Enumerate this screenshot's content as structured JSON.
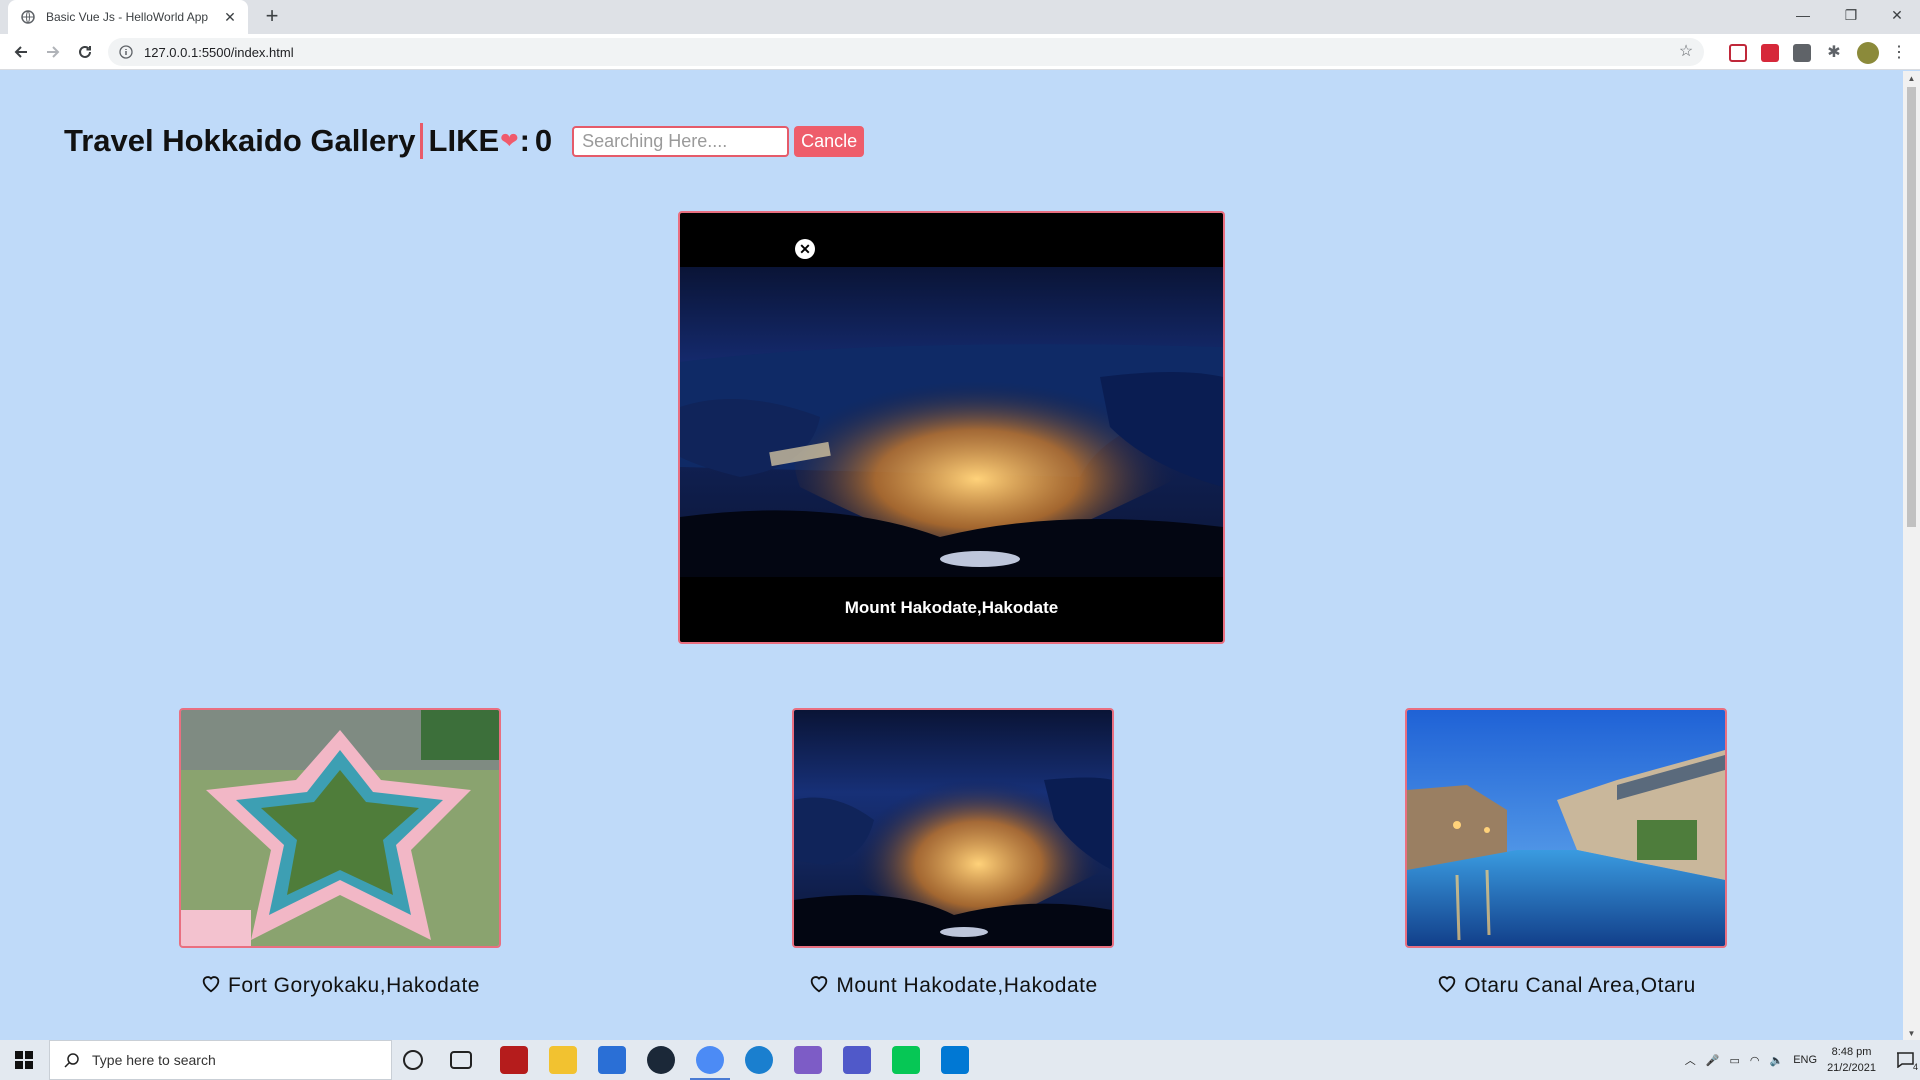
{
  "browser": {
    "tab_title": "Basic Vue Js - HelloWorld App",
    "url": "127.0.0.1:5500/index.html"
  },
  "app": {
    "title": "Travel Hokkaido Gallery",
    "like_label": "LIKE",
    "like_colon": ":",
    "like_count": "0",
    "search_placeholder": "Searching Here....",
    "cancel_label": "Cancle"
  },
  "lightbox": {
    "caption": "Mount Hakodate,Hakodate"
  },
  "gallery": [
    {
      "caption": "Fort Goryokaku,Hakodate"
    },
    {
      "caption": "Mount Hakodate,Hakodate"
    },
    {
      "caption": "Otaru Canal Area,Otaru"
    }
  ],
  "taskbar": {
    "search_placeholder": "Type here to search",
    "language": "ENG",
    "time": "8:48 pm",
    "date": "21/2/2021",
    "notification_count": "4"
  },
  "colors": {
    "page_background": "#bfdaf9",
    "accent": "#ee5d6b"
  }
}
